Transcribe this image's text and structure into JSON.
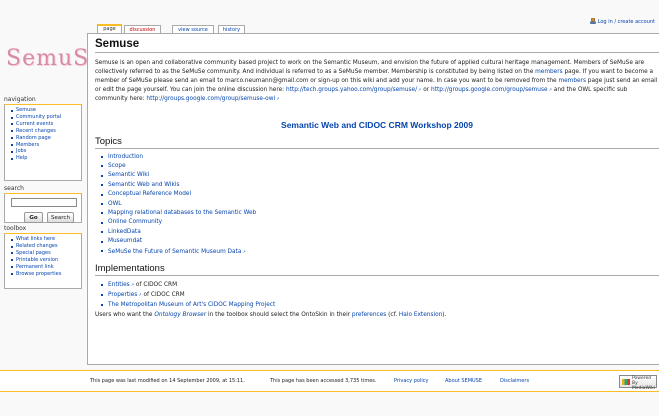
{
  "logo": {
    "text": "SemuSe"
  },
  "user": {
    "login_label": "Log in / create account"
  },
  "tabs": [
    {
      "label": "page"
    },
    {
      "label": "discussion"
    },
    {
      "label": "view source"
    },
    {
      "label": "history"
    }
  ],
  "sidebar": {
    "navigation": {
      "title": "navigation",
      "items": [
        "Semuse",
        "Community portal",
        "Current events",
        "Recent changes",
        "Random page",
        "Members",
        "Jobs",
        "Help"
      ]
    },
    "search": {
      "title": "search",
      "go_label": "Go",
      "search_label": "Search"
    },
    "toolbox": {
      "title": "toolbox",
      "items": [
        "What links here",
        "Related changes",
        "Special pages",
        "Printable version",
        "Permanent link",
        "Browse properties"
      ]
    }
  },
  "content": {
    "title": "Semuse",
    "intro": {
      "p1": "Semuse is an open and collaborative community based project to work on the Semantic Museum, and envision the future of applied cultural heritage management. Members of SeMuSe are collectively referred to as the SeMuSe community. And individual is referred to as a SeMuSe member. Membership is constituted by being listed on the ",
      "members_link": "members",
      "p2": " page. If you want to become a member of SeMuSe please send an email to marco.neumann@gmail.com or sign-up on this wiki and add your name. In case you want to be removed from the ",
      "p3": " page just send an email or edit the page yourself. You can join the online discussion here: ",
      "yahoo_link": "http://tech.groups.yahoo.com/group/semuse/",
      "or": " or ",
      "google_link": "http://groups.google.com/group/semuse",
      "p4": " and the OWL specific sub community here: ",
      "owl_link": "http://groups.google.com/group/semuse-owl"
    },
    "workshop_link": "Semantic Web and CIDOC CRM Workshop 2009",
    "topics": {
      "heading": "Topics",
      "items": [
        "Introduction",
        "Scope",
        "Semantic Wiki",
        "Semantic Web and Wikis",
        "Conceptual Reference Model",
        "OWL",
        "Mapping relational databases to the Semantic Web",
        "Online Community",
        "LinkedData",
        "Museumdat",
        "SeMuSe the Future of Semantic Museum Data"
      ]
    },
    "implementations": {
      "heading": "Implementations",
      "entities": "Entities",
      "properties": "Properties",
      "of_cidoc": " of CIDOC CRM",
      "met": "The Metropolitan Museum of Art's CIDOC Mapping Project",
      "note_pre": "Users who want the ",
      "note_browser": "Ontology Browser",
      "note_mid": " in the toolbox should select the OntoSkin in their ",
      "note_pref": "preferences",
      "note_cf": " (cf. ",
      "note_halo": "Halo Extension",
      "note_end": ")."
    }
  },
  "footer": {
    "modified": "This page was last modified on 14 September 2009, at 15:11.",
    "accessed": "This page has been accessed 3,735 times.",
    "privacy": "Privacy policy",
    "about": "About SEMUSE",
    "disclaimers": "Disclaimers",
    "badge": "Powered By MediaWiki"
  }
}
